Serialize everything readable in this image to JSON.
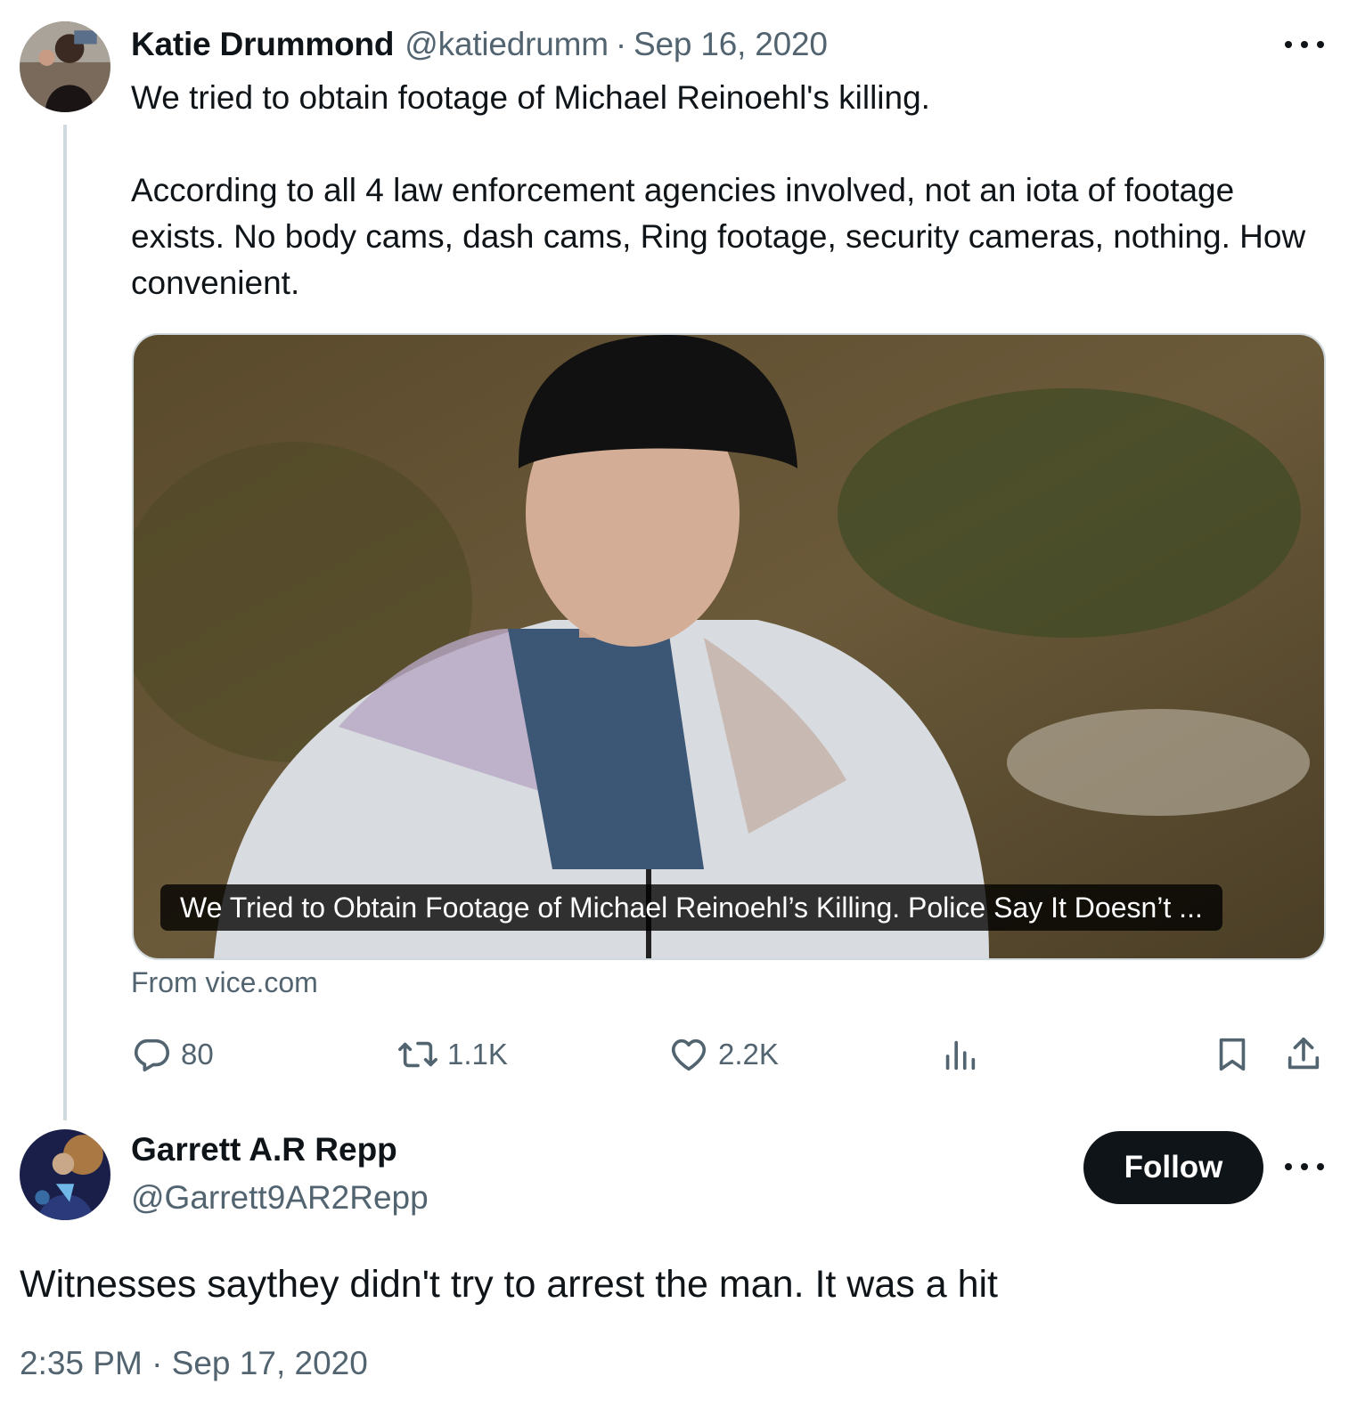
{
  "tweet_1": {
    "author_name": "Katie Drummond",
    "handle": "@katiedrumm",
    "separator": "·",
    "date": "Sep 16, 2020",
    "text": "We tried to obtain footage of Michael Reinoehl's killing.\n\nAccording to all 4 law enforcement agencies involved, not an iota of footage exists. No body cams, dash cams, Ring footage, security cameras, nothing. How convenient.",
    "card": {
      "caption": "We Tried to Obtain Footage of Michael Reinoehl’s Killing. Police Say It Doesn’t ...",
      "source": "From vice.com"
    },
    "actions": {
      "replies": "80",
      "retweets": "1.1K",
      "likes": "2.2K"
    }
  },
  "tweet_2": {
    "author_name": "Garrett A.R Repp",
    "handle": "@Garrett9AR2Repp",
    "follow_label": "Follow",
    "text": "Witnesses saythey didn't try to arrest the man. It was a hit",
    "timestamp": "2:35 PM · Sep 17, 2020"
  },
  "icons": {
    "reply": "reply-icon",
    "retweet": "retweet-icon",
    "like": "heart-icon",
    "views": "views-chart-icon",
    "bookmark": "bookmark-icon",
    "share": "share-icon",
    "more": "more-icon"
  },
  "colors": {
    "text_primary": "#0f1419",
    "text_secondary": "#536471",
    "thread_line": "#cfd9de",
    "follow_button": "#0f1419"
  }
}
